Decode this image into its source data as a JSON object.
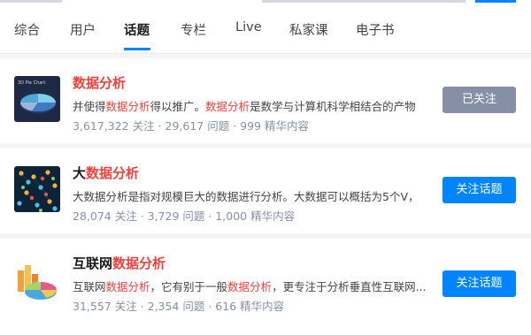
{
  "tabs": [
    {
      "label": "综合",
      "active": false
    },
    {
      "label": "用户",
      "active": false
    },
    {
      "label": "话题",
      "active": true
    },
    {
      "label": "专栏",
      "active": false
    },
    {
      "label": "Live",
      "active": false
    },
    {
      "label": "私家课",
      "active": false
    },
    {
      "label": "电子书",
      "active": false
    }
  ],
  "colors": {
    "accent": "#0084ff",
    "highlight": "#f1403c",
    "meta": "#8590a6",
    "followed": "#8590a6"
  },
  "results": [
    {
      "thumb_icon": "pie-chart-icon",
      "thumb_label": "3D Pie Chart",
      "title_pre": "",
      "title_hl": "数据分析",
      "desc_pre": "并使得",
      "desc_hl1": "数据分析",
      "desc_mid": "得以推广。",
      "desc_hl2": "数据分析",
      "desc_post": "是数学与计算机科学相结合的产物",
      "meta": "3,617,322 关注 · 29,617 问题 · 999 精华内容",
      "button": "已关注"
    },
    {
      "thumb_icon": "network-icon",
      "title_pre": "大",
      "title_hl": "数据分析",
      "desc_pre": "大数据分析是指对规模巨大的数据进行分析。大数据可以概括为5个V，",
      "desc_hl1": "",
      "desc_mid": "",
      "desc_hl2": "",
      "desc_post": "",
      "meta": "28,074 关注 · 3,729 问题 · 1,000 精华内容",
      "button": "关注话题"
    },
    {
      "thumb_icon": "chart-3d-icon",
      "title_pre": "互联网",
      "title_hl": "数据分析",
      "desc_pre": "互联网",
      "desc_hl1": "数据分析",
      "desc_mid": "，它有别于一般",
      "desc_hl2": "数据分析",
      "desc_post": "，更专注于分析垂直性互联网...",
      "meta": "31,557 关注 · 2,354 问题 · 616 精华内容",
      "button": "关注话题"
    }
  ]
}
